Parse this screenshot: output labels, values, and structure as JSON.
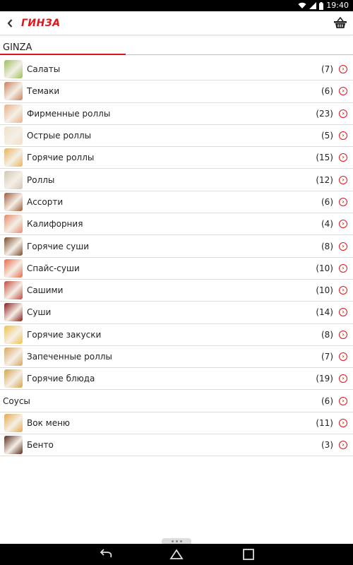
{
  "status": {
    "time": "19:40"
  },
  "app": {
    "logo": "ГИНЗА"
  },
  "section": {
    "title": "GINZA"
  },
  "colors": {
    "accent": "#e2131a"
  },
  "menu": [
    {
      "label": "Салаты",
      "count": "(7)",
      "thumb": "#9bbf5a"
    },
    {
      "label": "Темаки",
      "count": "(6)",
      "thumb": "#c9805a"
    },
    {
      "label": "Фирменные роллы",
      "count": "(23)",
      "thumb": "#e7b08a"
    },
    {
      "label": "Острые роллы",
      "count": "(5)",
      "thumb": "#efe0c8"
    },
    {
      "label": "Горячие роллы",
      "count": "(15)",
      "thumb": "#e8b45a"
    },
    {
      "label": "Роллы",
      "count": "(12)",
      "thumb": "#d2c6b6"
    },
    {
      "label": "Ассорти",
      "count": "(6)",
      "thumb": "#a0593a"
    },
    {
      "label": "Калифорния",
      "count": "(4)",
      "thumb": "#e58b6a"
    },
    {
      "label": "Горячие суши",
      "count": "(8)",
      "thumb": "#7a4a2a"
    },
    {
      "label": "Спайс-суши",
      "count": "(10)",
      "thumb": "#e86a4a"
    },
    {
      "label": "Сашими",
      "count": "(10)",
      "thumb": "#c14a3a"
    },
    {
      "label": "Суши",
      "count": "(14)",
      "thumb": "#8a1a1a"
    },
    {
      "label": "Горячие закуски",
      "count": "(8)",
      "thumb": "#f0c24a"
    },
    {
      "label": "Запеченные роллы",
      "count": "(7)",
      "thumb": "#d9a560"
    },
    {
      "label": "Горячие блюда",
      "count": "(19)",
      "thumb": "#d8a24a"
    },
    {
      "label": "Соусы",
      "count": "(6)",
      "thumb": ""
    },
    {
      "label": "Вок меню",
      "count": "(11)",
      "thumb": "#e6a84a"
    },
    {
      "label": "Бенто",
      "count": "(3)",
      "thumb": "#5a2a1a"
    }
  ]
}
